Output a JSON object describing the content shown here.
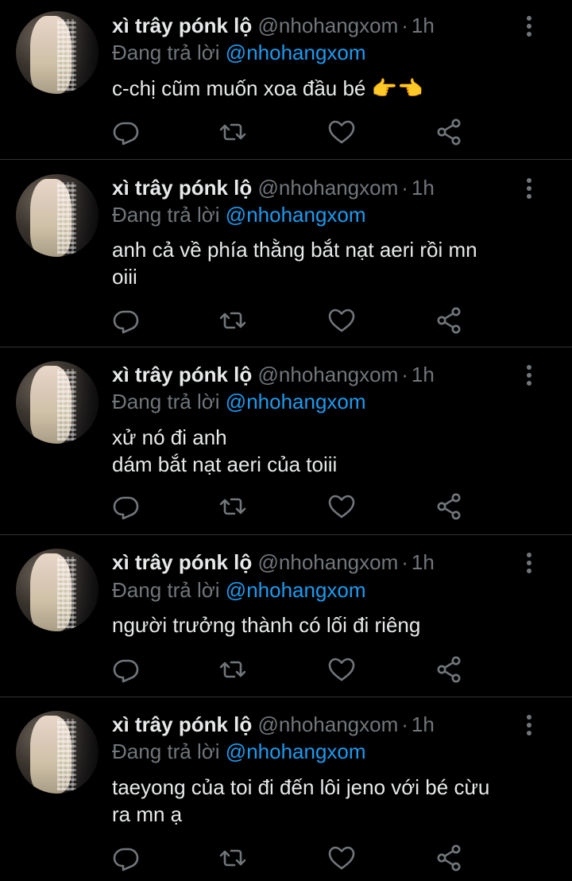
{
  "colors": {
    "background": "#000000",
    "text": "#e7e9ea",
    "muted": "#71767b",
    "accent": "#1d9bf0",
    "divider": "#2f3336"
  },
  "icons": {
    "reply": "reply-icon",
    "retweet": "retweet-icon",
    "like": "like-icon",
    "share": "share-icon",
    "more": "more-options-icon"
  },
  "tweets": [
    {
      "name": "xì trây pónk lộ",
      "handle": "@nhohangxom",
      "dot": "·",
      "time": "1h",
      "reply_prefix": "Đang trả lời",
      "reply_to": "@nhohangxom",
      "lines": [
        "c-chị cũm muốn xoa đầu bé 👉👈"
      ]
    },
    {
      "name": "xì trây pónk lộ",
      "handle": "@nhohangxom",
      "dot": "·",
      "time": "1h",
      "reply_prefix": "Đang trả lời",
      "reply_to": "@nhohangxom",
      "lines": [
        "anh cả về phía thằng bắt nạt aeri rồi mn",
        "oiii"
      ]
    },
    {
      "name": "xì trây pónk lộ",
      "handle": "@nhohangxom",
      "dot": "·",
      "time": "1h",
      "reply_prefix": "Đang trả lời",
      "reply_to": "@nhohangxom",
      "lines": [
        "xử nó đi anh",
        "dám bắt nạt aeri của toiii"
      ]
    },
    {
      "name": "xì trây pónk lộ",
      "handle": "@nhohangxom",
      "dot": "·",
      "time": "1h",
      "reply_prefix": "Đang trả lời",
      "reply_to": "@nhohangxom",
      "lines": [
        "người trưởng thành có lối đi riêng"
      ]
    },
    {
      "name": "xì trây pónk lộ",
      "handle": "@nhohangxom",
      "dot": "·",
      "time": "1h",
      "reply_prefix": "Đang trả lời",
      "reply_to": "@nhohangxom",
      "lines": [
        "taeyong của toi đi đến lôi jeno với bé cừu",
        "ra mn ạ"
      ]
    }
  ]
}
